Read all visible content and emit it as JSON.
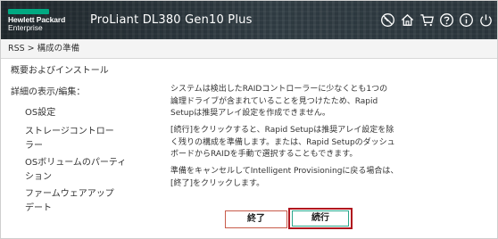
{
  "header": {
    "brand_line1": "Hewlett Packard",
    "brand_line2": "Enterprise",
    "brand_color": "#01a982",
    "product": "ProLiant DL380 Gen10 Plus",
    "icons": [
      "globe-icon",
      "home-icon",
      "cart-icon",
      "help-icon",
      "info-icon",
      "power-icon"
    ]
  },
  "breadcrumb": "RSS > 構成の準備",
  "nav": {
    "overview": "概要およびインストール",
    "details": "詳細の表示/編集：",
    "os_settings": "OS設定",
    "storage_line1": "ストレージコントロー",
    "storage_line2": "ラー",
    "os_volume_line1": "OSボリュームのパーティ",
    "os_volume_line2": "ション",
    "firmware_line1": "ファームウェアアップ",
    "firmware_line2": "デート"
  },
  "main": {
    "para1": [
      "システムは検出したRAIDコントローラーに少なくとも1つの",
      "論理ドライブが含まれていることを見つけたため、Rapid",
      "Setupは推奨アレイ設定を作成できません。"
    ],
    "para2": [
      "[続行]をクリックすると、Rapid Setupは推奨アレイ設定を除",
      "く残りの構成を準備します。または、Rapid Setupのダッシュ",
      "ボードからRAIDを手動で選択することもできます。"
    ],
    "para3": [
      "準備をキャンセルしてIntelligent Provisioningに戻る場合は、",
      "[終了]をクリックします。"
    ]
  },
  "buttons": {
    "cancel": "終了",
    "continue": "続行"
  },
  "colors": {
    "header_bg": "#2e3a41",
    "button_border": "#c85b4a",
    "highlight": "#b0161e",
    "continue_border": "#2aa58a"
  }
}
